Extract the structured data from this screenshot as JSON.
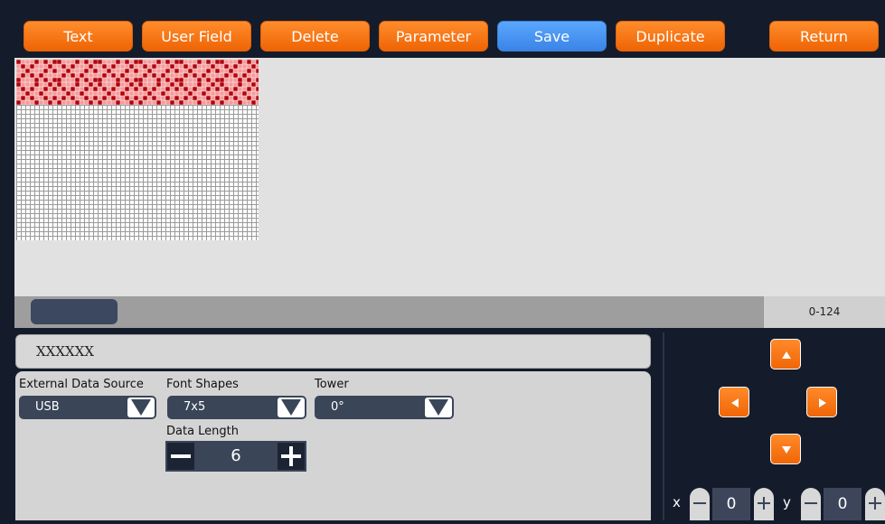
{
  "toolbar": {
    "text_label": "Text",
    "user_field_label": "User Field",
    "delete_label": "Delete",
    "parameter_label": "Parameter",
    "save_label": "Save",
    "duplicate_label": "Duplicate",
    "return_label": "Return"
  },
  "canvas": {
    "range_label": "0-124"
  },
  "text_value": "XXXXXX",
  "props": {
    "external_data_source": {
      "label": "External Data Source",
      "value": "USB"
    },
    "font_shapes": {
      "label": "Font Shapes",
      "value": "7x5"
    },
    "tower": {
      "label": "Tower",
      "value": "0°"
    },
    "data_length": {
      "label": "Data Length",
      "value": "6"
    }
  },
  "position": {
    "x_label": "x",
    "x_value": "0",
    "y_label": "y",
    "y_value": "0"
  },
  "colors": {
    "accent_orange": "#f47a14",
    "save_blue": "#4a96f2",
    "dot_on": "#b3000c",
    "dot_bg": "#f59b9b"
  },
  "icons": [
    "minus-icon",
    "plus-icon",
    "dropdown-arrow-icon",
    "arrow-up-icon",
    "arrow-down-icon",
    "arrow-left-icon",
    "arrow-right-icon"
  ]
}
